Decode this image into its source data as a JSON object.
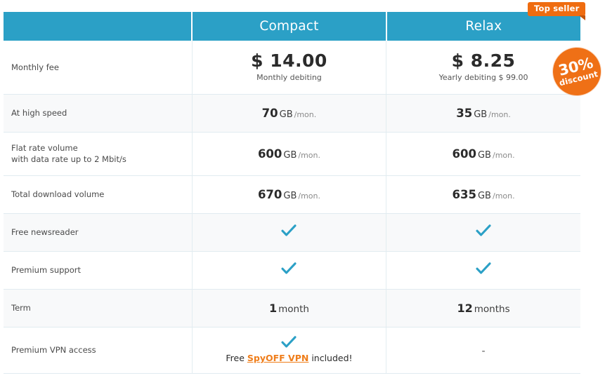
{
  "colors": {
    "header_blue": "#2ba0c6",
    "accent_orange": "#ef7016",
    "ribbon_orange": "#ef6c10",
    "check_blue": "#2ba0c6",
    "link_orange": "#ef7d1a",
    "row_alt": "#f8f9fa",
    "border": "#e1ebf0"
  },
  "badges": {
    "top_seller": "Top seller",
    "discount_percent": "30%",
    "discount_word": "discount"
  },
  "header": {
    "feature_column": "",
    "plans": [
      {
        "name": "Compact"
      },
      {
        "name": "Relax"
      }
    ]
  },
  "rows": [
    {
      "label": "Monthly fee",
      "label_line2": "",
      "type": "price",
      "cells": [
        {
          "amount": "$ 14.00",
          "sub": "Monthly debiting"
        },
        {
          "amount": "$ 8.25",
          "sub": "Yearly debiting $ 99.00"
        }
      ]
    },
    {
      "label": "At high speed",
      "label_line2": "",
      "type": "volume",
      "cells": [
        {
          "num": "70",
          "unit": "GB",
          "per": "/mon."
        },
        {
          "num": "35",
          "unit": "GB",
          "per": "/mon."
        }
      ]
    },
    {
      "label": "Flat rate volume",
      "label_line2": "with data rate up to 2 Mbit/s",
      "type": "volume",
      "cells": [
        {
          "num": "600",
          "unit": "GB",
          "per": "/mon."
        },
        {
          "num": "600",
          "unit": "GB",
          "per": "/mon."
        }
      ]
    },
    {
      "label": "Total download volume",
      "label_line2": "",
      "type": "volume",
      "cells": [
        {
          "num": "670",
          "unit": "GB",
          "per": "/mon."
        },
        {
          "num": "635",
          "unit": "GB",
          "per": "/mon."
        }
      ]
    },
    {
      "label": "Free newsreader",
      "label_line2": "",
      "type": "check",
      "cells": [
        {
          "check": true
        },
        {
          "check": true
        }
      ]
    },
    {
      "label": "Premium support",
      "label_line2": "",
      "type": "check",
      "cells": [
        {
          "check": true
        },
        {
          "check": true
        }
      ]
    },
    {
      "label": "Term",
      "label_line2": "",
      "type": "term",
      "cells": [
        {
          "num": "1",
          "unit": "month"
        },
        {
          "num": "12",
          "unit": "months"
        }
      ]
    },
    {
      "label": "Premium VPN access",
      "label_line2": "",
      "type": "vpn",
      "cells": [
        {
          "check": true,
          "text_before": "Free ",
          "link": "SpyOFF VPN",
          "text_after": " included!"
        },
        {
          "check": false,
          "dash": "-"
        }
      ]
    }
  ],
  "icons": {
    "check": "check-icon"
  }
}
